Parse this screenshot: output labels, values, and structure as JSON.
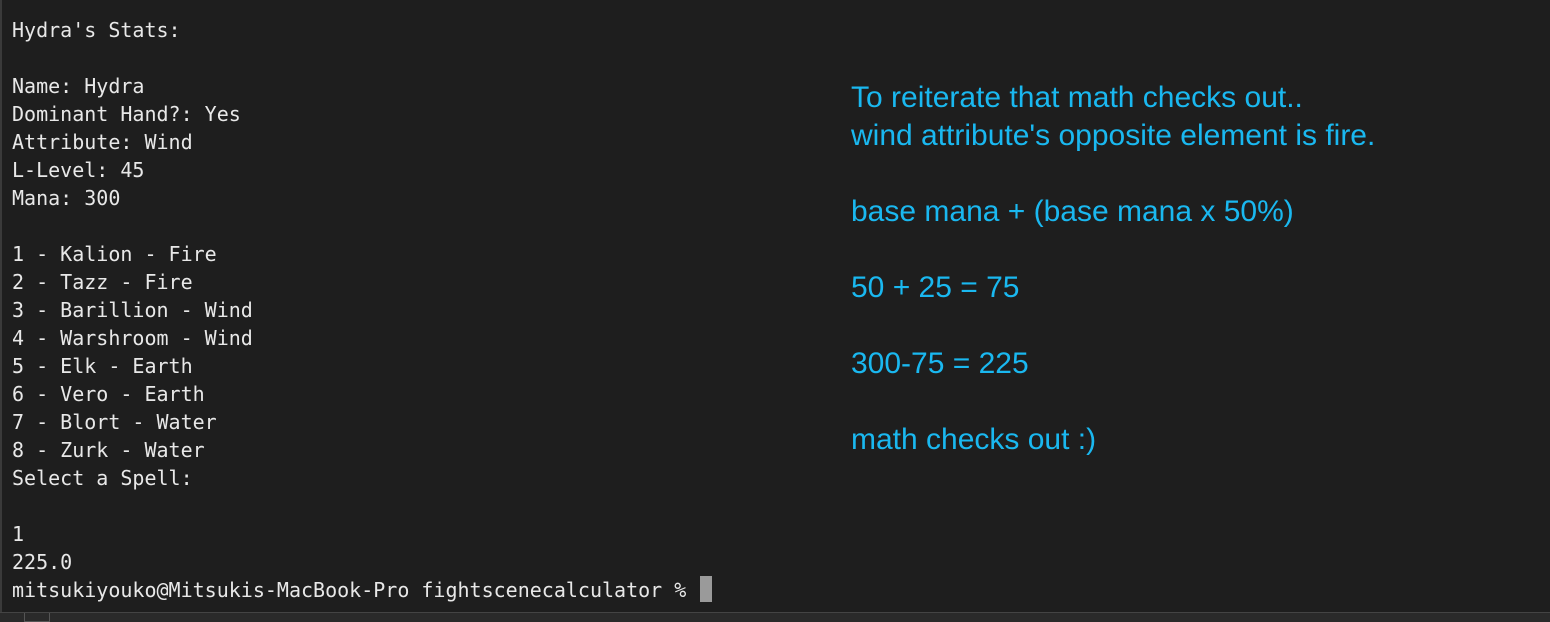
{
  "terminal": {
    "stats_header": "Hydra's Stats:",
    "stats": {
      "name": "Name: Hydra",
      "dominant_hand": "Dominant Hand?: Yes",
      "attribute": "Attribute: Wind",
      "l_level": "L-Level: 45",
      "mana": "Mana: 300"
    },
    "spells": [
      "1 - Kalion - Fire",
      "2 - Tazz - Fire",
      "3 - Barillion - Wind",
      "4 - Warshroom - Wind",
      "5 - Elk - Earth",
      "6 - Vero - Earth",
      "7 - Blort - Water",
      "8 - Zurk - Water"
    ],
    "prompt_text": "Select a Spell:",
    "user_input": "1",
    "output": "225.0",
    "shell_prompt": "mitsukiyouko@Mitsukis-MacBook-Pro fightscenecalculator % "
  },
  "annotation": {
    "line1": "To reiterate that math checks out..",
    "line2": "wind attribute's opposite element is fire.",
    "formula": "base mana + (base mana x 50%)",
    "calc1": "50 + 25 = 75",
    "calc2": "300-75 = 225",
    "conclusion": "math checks out :)"
  },
  "colors": {
    "background": "#1e1e1e",
    "terminal_text": "#e8e8e8",
    "annotation_text": "#1ab8f0",
    "cursor": "#9a9a9a"
  }
}
